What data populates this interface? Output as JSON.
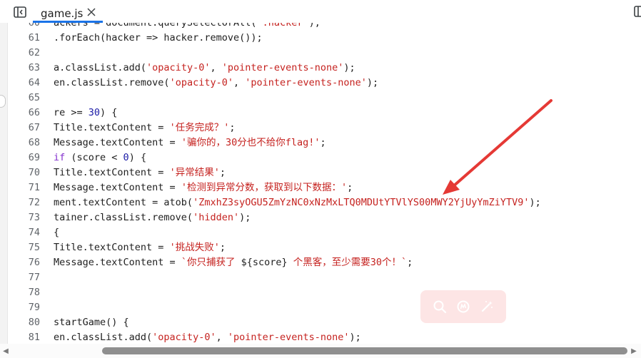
{
  "tab": {
    "title": "game.js"
  },
  "lines": [
    {
      "num": "60",
      "parts": [
        {
          "t": "ackers = document.querySelectorAll(",
          "c": "fn"
        },
        {
          "t": "'.hacker'",
          "c": "str"
        },
        {
          "t": ");",
          "c": "fn"
        }
      ]
    },
    {
      "num": "61",
      "parts": [
        {
          "t": ".forEach(hacker => hacker.remove());",
          "c": "fn"
        }
      ]
    },
    {
      "num": "62",
      "parts": []
    },
    {
      "num": "63",
      "parts": [
        {
          "t": "a.classList.add(",
          "c": "fn"
        },
        {
          "t": "'opacity-0'",
          "c": "str"
        },
        {
          "t": ", ",
          "c": "fn"
        },
        {
          "t": "'pointer-events-none'",
          "c": "str"
        },
        {
          "t": ");",
          "c": "fn"
        }
      ]
    },
    {
      "num": "64",
      "parts": [
        {
          "t": "en.classList.remove(",
          "c": "fn"
        },
        {
          "t": "'opacity-0'",
          "c": "str"
        },
        {
          "t": ", ",
          "c": "fn"
        },
        {
          "t": "'pointer-events-none'",
          "c": "str"
        },
        {
          "t": ");",
          "c": "fn"
        }
      ]
    },
    {
      "num": "65",
      "parts": []
    },
    {
      "num": "66",
      "parts": [
        {
          "t": "re >= ",
          "c": "fn"
        },
        {
          "t": "30",
          "c": "num"
        },
        {
          "t": ") {",
          "c": "fn"
        }
      ]
    },
    {
      "num": "67",
      "parts": [
        {
          "t": "Title.textContent = ",
          "c": "fn"
        },
        {
          "t": "'任务完成？'",
          "c": "str"
        },
        {
          "t": ";",
          "c": "fn"
        }
      ]
    },
    {
      "num": "68",
      "parts": [
        {
          "t": "Message.textContent = ",
          "c": "fn"
        },
        {
          "t": "'骗你的，30分也不给你flag!'",
          "c": "str"
        },
        {
          "t": ";",
          "c": "fn"
        }
      ]
    },
    {
      "num": "69",
      "parts": [
        {
          "t": "if",
          "c": "kw"
        },
        {
          "t": " (score < ",
          "c": "fn"
        },
        {
          "t": "0",
          "c": "num"
        },
        {
          "t": ") {",
          "c": "fn"
        }
      ]
    },
    {
      "num": "70",
      "parts": [
        {
          "t": "Title.textContent = ",
          "c": "fn"
        },
        {
          "t": "'异常结果'",
          "c": "str"
        },
        {
          "t": ";",
          "c": "fn"
        }
      ]
    },
    {
      "num": "71",
      "parts": [
        {
          "t": "Message.textContent = ",
          "c": "fn"
        },
        {
          "t": "'检测到异常分数，获取到以下数据：'",
          "c": "str"
        },
        {
          "t": ";",
          "c": "fn"
        }
      ]
    },
    {
      "num": "72",
      "parts": [
        {
          "t": "ment.textContent = atob(",
          "c": "fn"
        },
        {
          "t": "'ZmxhZ3syOGU5ZmYzNC0xNzMxLTQ0MDUtYTVlYS00MWY2YjUyYmZiYTV9'",
          "c": "str"
        },
        {
          "t": ");",
          "c": "fn"
        }
      ]
    },
    {
      "num": "73",
      "parts": [
        {
          "t": "tainer.classList.remove(",
          "c": "fn"
        },
        {
          "t": "'hidden'",
          "c": "str"
        },
        {
          "t": ");",
          "c": "fn"
        }
      ]
    },
    {
      "num": "74",
      "parts": [
        {
          "t": "{",
          "c": "fn"
        }
      ]
    },
    {
      "num": "75",
      "parts": [
        {
          "t": "Title.textContent = ",
          "c": "fn"
        },
        {
          "t": "'挑战失败'",
          "c": "str"
        },
        {
          "t": ";",
          "c": "fn"
        }
      ]
    },
    {
      "num": "76",
      "parts": [
        {
          "t": "Message.textContent = ",
          "c": "fn"
        },
        {
          "t": "`你只捕获了 ",
          "c": "str"
        },
        {
          "t": "${score}",
          "c": "fn"
        },
        {
          "t": " 个黑客，至少需要30个！`",
          "c": "str"
        },
        {
          "t": ";",
          "c": "fn"
        }
      ]
    },
    {
      "num": "77",
      "parts": []
    },
    {
      "num": "78",
      "parts": []
    },
    {
      "num": "79",
      "parts": []
    },
    {
      "num": "80",
      "parts": [
        {
          "t": "startGame() {",
          "c": "fn"
        }
      ]
    },
    {
      "num": "81",
      "parts": [
        {
          "t": "en.classList.add(",
          "c": "fn"
        },
        {
          "t": "'opacity-0'",
          "c": "str"
        },
        {
          "t": ", ",
          "c": "fn"
        },
        {
          "t": "'pointer-events-none'",
          "c": "str"
        },
        {
          "t": ");",
          "c": "fn"
        }
      ]
    }
  ],
  "annotation": {
    "arrow_color": "#e53935"
  },
  "icons": {
    "sidebar_toggle": "sidebar-toggle-icon",
    "tab_close": "close-icon",
    "right_panel_toggle": "panel-toggle-icon",
    "search": "search-icon",
    "ai_chat": "ai-chat-icon",
    "magic": "magic-wand-icon"
  },
  "scrollbar": {
    "left_arrow": "◀",
    "right_arrow": "▶"
  }
}
